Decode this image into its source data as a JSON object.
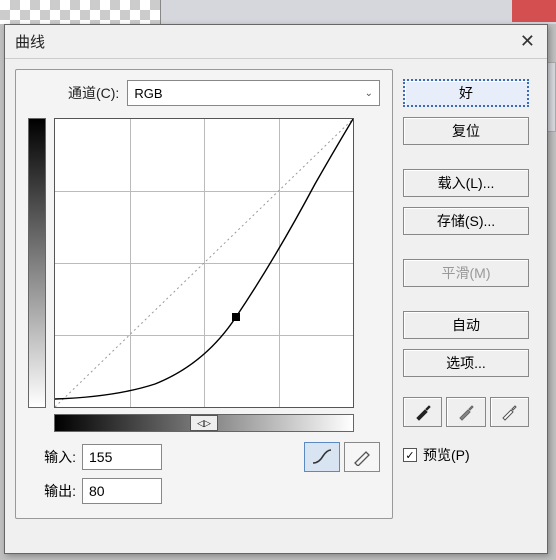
{
  "dialog": {
    "title": "曲线"
  },
  "channel": {
    "label": "通道(C):",
    "selected": "RGB"
  },
  "input": {
    "label": "输入:",
    "value": "155"
  },
  "output": {
    "label": "输出:",
    "value": "80"
  },
  "buttons": {
    "ok": "好",
    "reset": "复位",
    "load": "载入(L)...",
    "save": "存储(S)...",
    "smooth": "平滑(M)",
    "auto": "自动",
    "options": "选项..."
  },
  "preview": {
    "label": "预览(P)",
    "checked": true
  },
  "tools": {
    "curve": "curve-tool",
    "pencil": "pencil-tool"
  },
  "icons": {
    "close": "✕",
    "chevron_down": "⌄",
    "check": "✓",
    "arrows": "◁▷"
  },
  "chart_data": {
    "type": "line",
    "title": "",
    "xlabel": "输入",
    "ylabel": "输出",
    "xlim": [
      0,
      255
    ],
    "ylim": [
      0,
      255
    ],
    "series": [
      {
        "name": "baseline",
        "style": "dashed",
        "points": [
          [
            0,
            0
          ],
          [
            255,
            255
          ]
        ]
      },
      {
        "name": "curve",
        "style": "solid",
        "points": [
          [
            0,
            8
          ],
          [
            40,
            10
          ],
          [
            80,
            20
          ],
          [
            120,
            45
          ],
          [
            155,
            80
          ],
          [
            185,
            125
          ],
          [
            215,
            180
          ],
          [
            240,
            225
          ],
          [
            255,
            255
          ]
        ]
      }
    ],
    "control_point": {
      "x": 155,
      "y": 80
    },
    "grid": {
      "x_divisions": 4,
      "y_divisions": 4
    }
  }
}
